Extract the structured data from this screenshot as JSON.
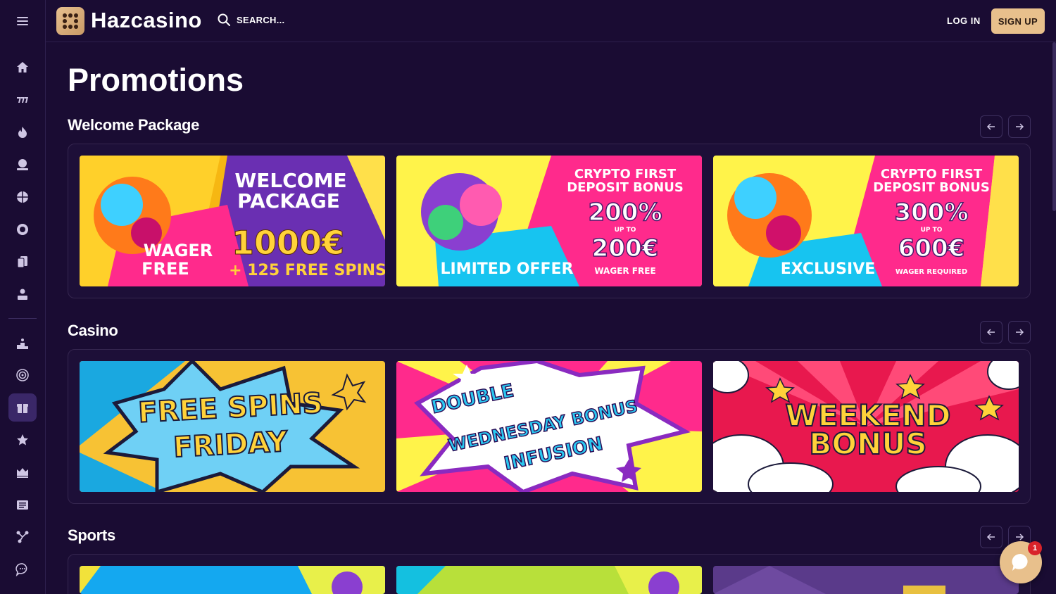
{
  "header": {
    "logo_text": "Hazcasino",
    "search_label": "SEARCH...",
    "login_label": "LOG IN",
    "signup_label": "SIGN UP"
  },
  "page": {
    "title": "Promotions"
  },
  "sidebar": {
    "items": [
      {
        "icon": "home-icon"
      },
      {
        "icon": "slots-icon"
      },
      {
        "icon": "fire-icon"
      },
      {
        "icon": "cash-stack-icon"
      },
      {
        "icon": "basketball-icon"
      },
      {
        "icon": "coin-icon"
      },
      {
        "icon": "cards-icon"
      },
      {
        "icon": "user-stand-icon"
      },
      {
        "icon": "leaderboard-icon"
      },
      {
        "icon": "target-icon"
      },
      {
        "icon": "gift-icon",
        "active": true
      },
      {
        "icon": "star-icon"
      },
      {
        "icon": "crown-icon"
      },
      {
        "icon": "news-icon"
      },
      {
        "icon": "affiliate-icon"
      },
      {
        "icon": "chat-icon"
      }
    ]
  },
  "sections": [
    {
      "title": "Welcome Package",
      "cards": [
        {
          "lines": [
            "WELCOME",
            "PACKAGE",
            "1000€",
            "+ 125 FREE SPINS",
            "WAGER",
            "FREE"
          ]
        },
        {
          "lines": [
            "CRYPTO FIRST",
            "DEPOSIT BONUS",
            "200%",
            "UP TO",
            "200€",
            "WAGER FREE",
            "LIMITED OFFER"
          ]
        },
        {
          "lines": [
            "CRYPTO FIRST",
            "DEPOSIT BONUS",
            "300%",
            "UP TO",
            "600€",
            "WAGER REQUIRED",
            "EXCLUSIVE"
          ]
        }
      ]
    },
    {
      "title": "Casino",
      "cards": [
        {
          "lines": [
            "FREE SPINS",
            "FRIDAY"
          ]
        },
        {
          "lines": [
            "DOUBLE",
            "WEDNESDAY BONUS",
            "INFUSION"
          ]
        },
        {
          "lines": [
            "WEEKEND",
            "BONUS"
          ]
        }
      ]
    },
    {
      "title": "Sports",
      "cards": []
    }
  ],
  "chat": {
    "badge": "1"
  },
  "colors": {
    "background": "#1a0c33",
    "accent": "#e8c08c",
    "panel": "#1d0f38"
  }
}
